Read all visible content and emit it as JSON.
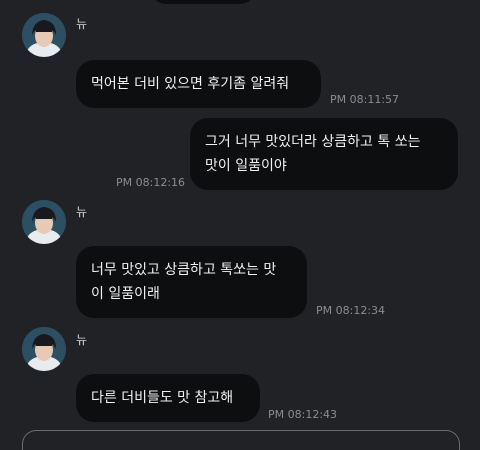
{
  "colors": {
    "background": "#202226",
    "bubble": "#0d0e10",
    "text": "#f1f1f2",
    "timestamp": "#8b8c91",
    "avatar_bg": "#2c4f63"
  },
  "messages": [
    {
      "type": "received",
      "sender": "뉴",
      "avatar_icon": "profile-avatar",
      "lines": [
        "먹어본 더비 있으면 후기좀 알려줘"
      ],
      "time": "PM 08:11:57"
    },
    {
      "type": "sent",
      "lines": [
        "그거 너무 맛있더라 상큼하고 톡 쏘는",
        "맛이 일품이야"
      ],
      "time": "PM 08:12:16"
    },
    {
      "type": "received",
      "sender": "뉴",
      "avatar_icon": "profile-avatar",
      "lines": [
        "너무 맛있고 상큼하고 톡쏘는 맛",
        "이 일품이래"
      ],
      "time": "PM 08:12:34"
    },
    {
      "type": "received",
      "sender": "뉴",
      "avatar_icon": "profile-avatar",
      "lines": [
        "다른 더비들도 맛 참고해"
      ],
      "time": "PM 08:12:43"
    }
  ]
}
